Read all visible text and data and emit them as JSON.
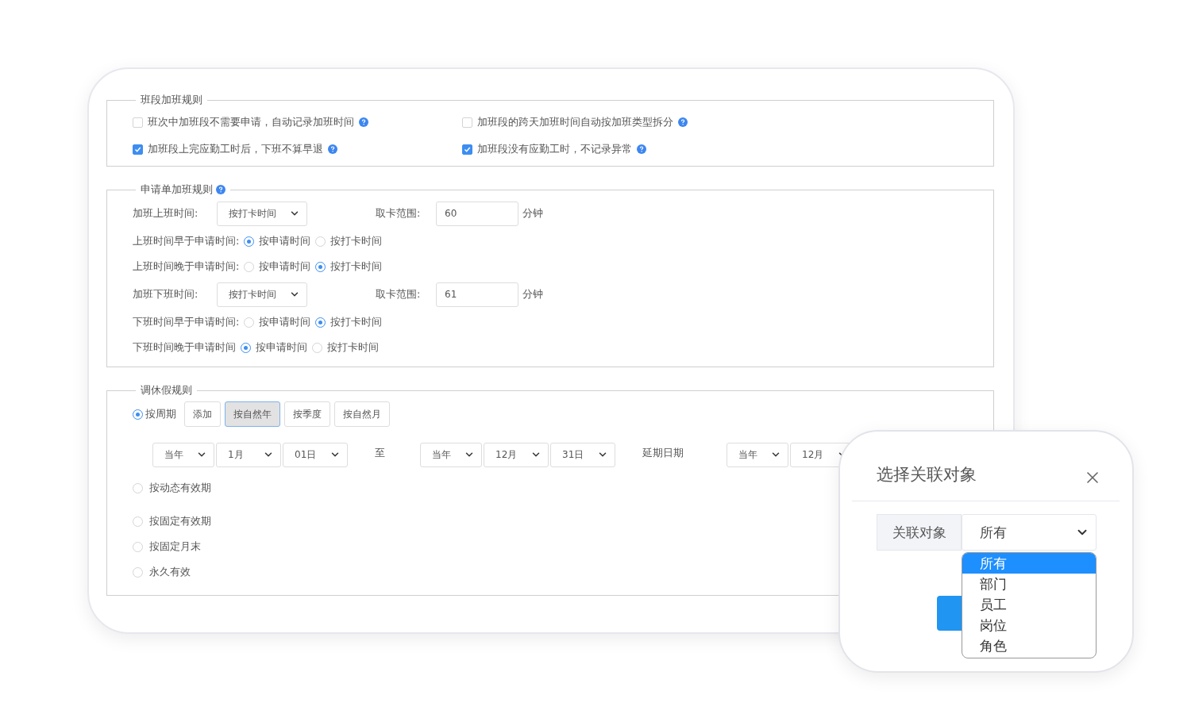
{
  "shift_rules": {
    "title": "班段加班规则",
    "items": [
      {
        "label": "班次中加班段不需要申请，自动记录加班时间",
        "checked": false,
        "help": true
      },
      {
        "label": "加班段的跨天加班时间自动按加班类型拆分",
        "checked": false,
        "help": true
      },
      {
        "label": "加班段上完应勤工时后，下班不算早退",
        "checked": true,
        "help": true
      },
      {
        "label": "加班段没有应勤工时，不记录异常",
        "checked": true,
        "help": true
      }
    ]
  },
  "application_rules": {
    "title": "申请单加班规则",
    "help": true,
    "rows": [
      {
        "kind": "select",
        "label": "加班上班时间:",
        "value": "按打卡时间",
        "range_label": "取卡范围:",
        "range_value": "60",
        "unit": "分钟"
      },
      {
        "kind": "radio",
        "label": "上班时间早于申请时间:",
        "options": [
          {
            "label": "按申请时间",
            "selected": true
          },
          {
            "label": "按打卡时间",
            "selected": false
          }
        ]
      },
      {
        "kind": "radio",
        "label": "上班时间晚于申请时间:",
        "options": [
          {
            "label": "按申请时间",
            "selected": false
          },
          {
            "label": "按打卡时间",
            "selected": true
          }
        ]
      },
      {
        "kind": "select",
        "label": "加班下班时间:",
        "value": "按打卡时间",
        "range_label": "取卡范围:",
        "range_value": "61",
        "unit": "分钟"
      },
      {
        "kind": "radio",
        "label": "下班时间早于申请时间:",
        "options": [
          {
            "label": "按申请时间",
            "selected": false
          },
          {
            "label": "按打卡时间",
            "selected": true
          }
        ]
      },
      {
        "kind": "radio",
        "label": "下班时间晚于申请时间",
        "options": [
          {
            "label": "按申请时间",
            "selected": true
          },
          {
            "label": "按打卡时间",
            "selected": false
          }
        ]
      }
    ]
  },
  "comp_leave_rules": {
    "title": "调休假规则",
    "period": {
      "label": "按周期",
      "selected": true
    },
    "period_buttons": [
      {
        "label": "添加",
        "selected": false
      },
      {
        "label": "按自然年",
        "selected": true
      },
      {
        "label": "按季度",
        "selected": false
      },
      {
        "label": "按自然月",
        "selected": false
      }
    ],
    "start_selects": [
      "当年",
      "1月",
      "01日"
    ],
    "separator": "至",
    "end_selects": [
      "当年",
      "12月",
      "31日"
    ],
    "extension_label": "延期日期",
    "extension_selects": [
      "当年",
      "12月"
    ],
    "options": [
      {
        "label": "按动态有效期",
        "selected": false
      },
      {
        "label": "按固定有效期",
        "selected": false
      },
      {
        "label": "按固定月末",
        "selected": false
      },
      {
        "label": "永久有效",
        "selected": false
      }
    ]
  },
  "dialog": {
    "title": "选择关联对象",
    "field_label": "关联对象",
    "value": "所有",
    "options": [
      {
        "label": "所有",
        "selected": true
      },
      {
        "label": "部门",
        "selected": false
      },
      {
        "label": "员工",
        "selected": false
      },
      {
        "label": "岗位",
        "selected": false
      },
      {
        "label": "角色",
        "selected": false
      }
    ]
  }
}
